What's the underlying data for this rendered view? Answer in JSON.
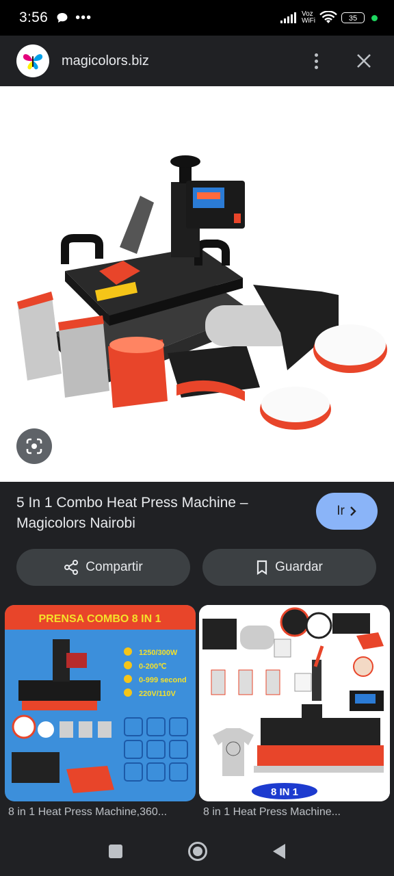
{
  "status_bar": {
    "time": "3:56",
    "network_top": "Voz",
    "network_bottom": "WiFi",
    "battery": "35"
  },
  "header": {
    "site_name": "magicolors.biz",
    "icons": [
      "logo-icon",
      "more-vert-icon",
      "close-icon"
    ]
  },
  "image": {
    "lens_icon": "google-lens-icon"
  },
  "result": {
    "title": "5 In 1 Combo Heat Press Machine – Magicolors Nairobi",
    "go_label": "Ir",
    "share_label": "Compartir",
    "save_label": "Guardar"
  },
  "related": [
    {
      "caption": "8 in 1 Heat Press Machine,360...",
      "banner": "PRENSA COMBO 8 IN 1",
      "specs": [
        "1250/300W",
        "0-200℃",
        "0-999 second",
        "220V/110V"
      ]
    },
    {
      "caption": "8 in 1 Heat Press Machine...",
      "badge": "8 IN 1"
    }
  ],
  "colors": {
    "accent": "#8ab4f8",
    "background": "#202124",
    "button": "#3c4043",
    "machine_red": "#e8452a"
  }
}
